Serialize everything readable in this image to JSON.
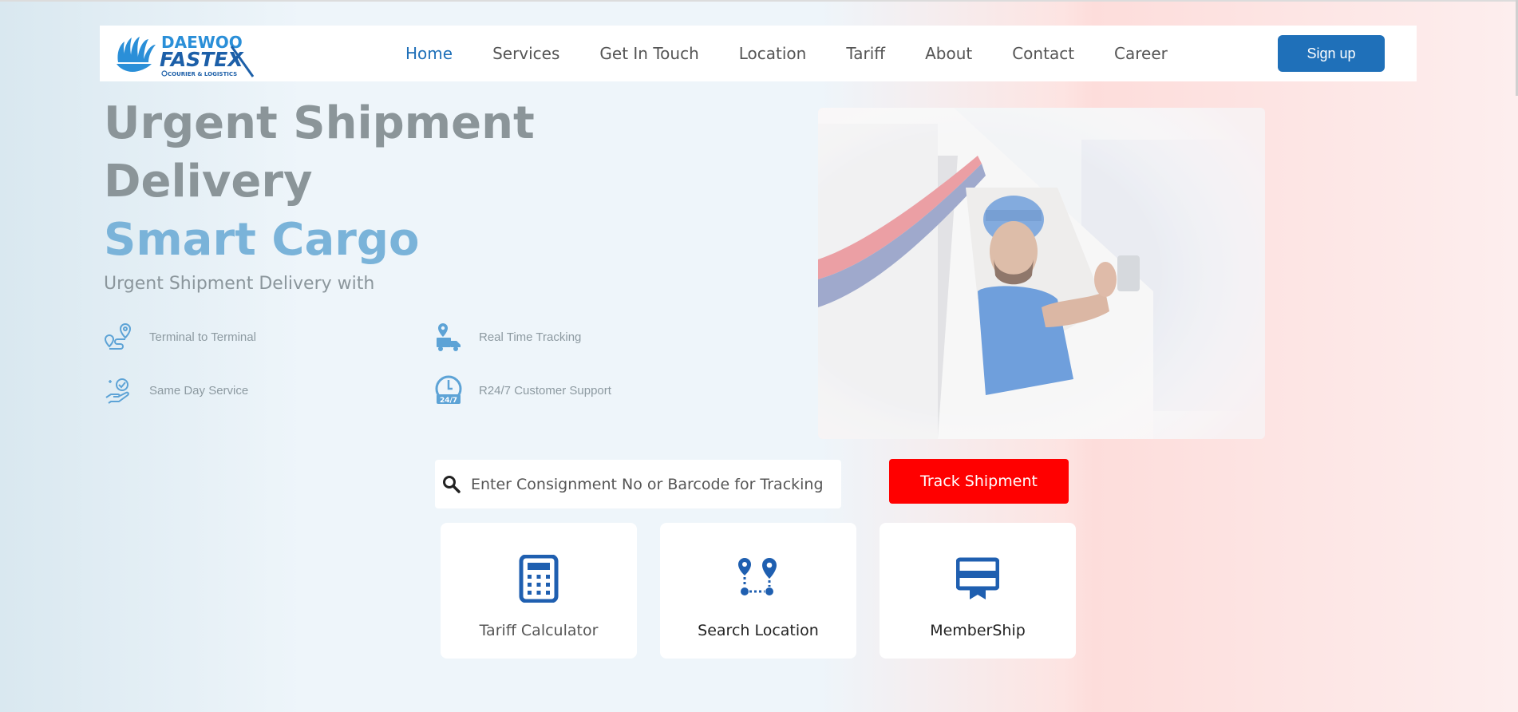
{
  "brand": {
    "logo_line1": "DAEWOO",
    "logo_line2": "FASTEX",
    "logo_tagline": "COURIER & LOGISTICS",
    "color": "#1f70b9"
  },
  "nav": {
    "items": [
      {
        "label": "Home",
        "active": true
      },
      {
        "label": "Services"
      },
      {
        "label": "Get In Touch"
      },
      {
        "label": "Location"
      },
      {
        "label": "Tariff"
      },
      {
        "label": "About"
      },
      {
        "label": "Contact"
      },
      {
        "label": "Career"
      }
    ],
    "signup_label": "Sign up"
  },
  "hero": {
    "title_line1": "Urgent Shipment",
    "title_line2": "Delivery",
    "title_line3": "Smart Cargo",
    "subtitle": "Urgent Shipment Delivery with",
    "features": [
      {
        "icon": "route-pin-icon",
        "label": "Terminal to Terminal"
      },
      {
        "icon": "delivery-tracking-icon",
        "label": "Real Time Tracking"
      },
      {
        "icon": "same-day-hand-icon",
        "label": "Same Day Service"
      },
      {
        "icon": "support-24-7-icon",
        "label": "R24/7 Customer Support"
      }
    ]
  },
  "tracking": {
    "placeholder": "Enter Consignment No or Barcode for Tracking",
    "button_label": "Track Shipment",
    "button_color": "#ff0000"
  },
  "cards": [
    {
      "icon": "calculator-icon",
      "label": "Tariff Calculator"
    },
    {
      "icon": "route-points-icon",
      "label": "Search Location"
    },
    {
      "icon": "membership-card-icon",
      "label": "MemberShip"
    }
  ]
}
